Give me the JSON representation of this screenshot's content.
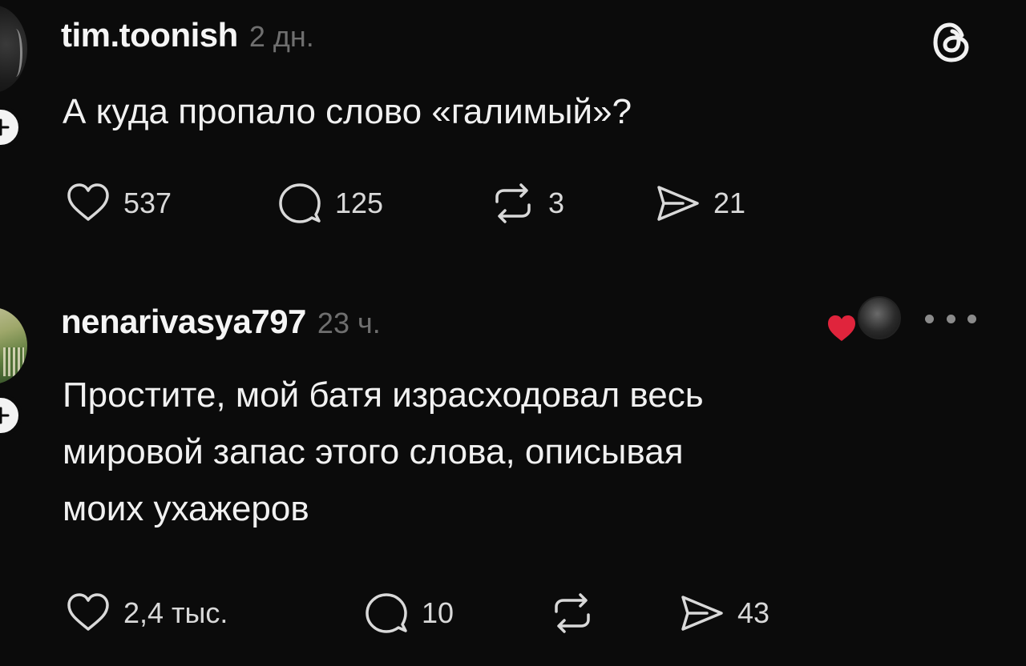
{
  "posts": [
    {
      "username": "tim.toonish",
      "time": "2 дн.",
      "text": "А куда пропало слово «галимый»?",
      "likes": "537",
      "comments": "125",
      "reposts": "3",
      "shares": "21",
      "platform_icon": "threads-logo-icon"
    },
    {
      "username": "nenarivasya797",
      "time": "23 ч.",
      "text": "Простите, мой батя израсходовал весь\nмировой запас этого слова, описывая\nмоих ухажеров",
      "likes": "2,4 тыс.",
      "comments": "10",
      "reposts": "",
      "shares": "43",
      "author_liked_icon": "heart-icon"
    }
  ],
  "colors": {
    "background": "#0b0b0b",
    "text": "#f1f1f1",
    "muted": "#6f6f6f",
    "heart": "#e0243c"
  }
}
